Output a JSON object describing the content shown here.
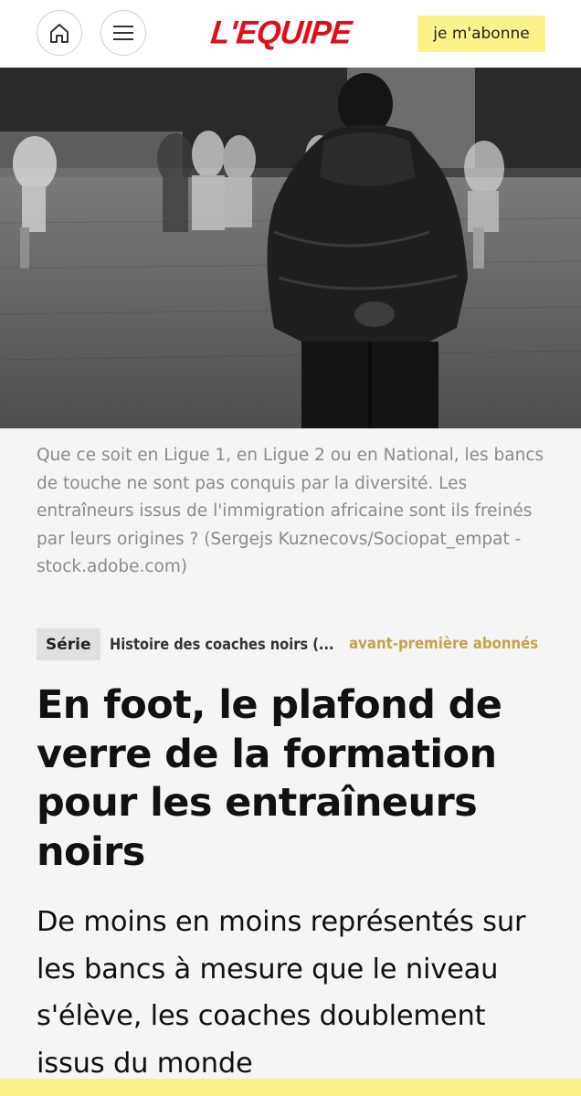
{
  "header": {
    "logo_text": "L'EQUIPE",
    "subscribe_label": "je m'abonne",
    "home_icon": "home-icon",
    "menu_icon": "menu-icon"
  },
  "hero": {
    "image_description_icon": "photo-coach-back-view"
  },
  "caption": "Que ce soit en Ligue 1, en Ligue 2 ou en National, les bancs de touche ne sont pas conquis par la diversité. Les entraîneurs issus de l'immigration africaine sont ils freinés par leurs origines ? (Sergejs Kuznecovs/Sociopat_empat - stock.adobe.com)",
  "series": {
    "tag": "Série",
    "name": "Histoire des coaches noirs (...",
    "premium": "avant-première abonnés"
  },
  "article": {
    "title": "En foot, le plafond de verre de la formation pour les entraîneurs noirs",
    "lead": "De moins en moins représentés sur les bancs à mesure que le niveau s'élève, les coaches doublement issus du monde"
  },
  "colors": {
    "brand_red": "#e20e17",
    "subscribe_yellow": "#fcf28a",
    "premium_gold": "#c4a44a",
    "caption_gray": "#8a8a8a"
  }
}
